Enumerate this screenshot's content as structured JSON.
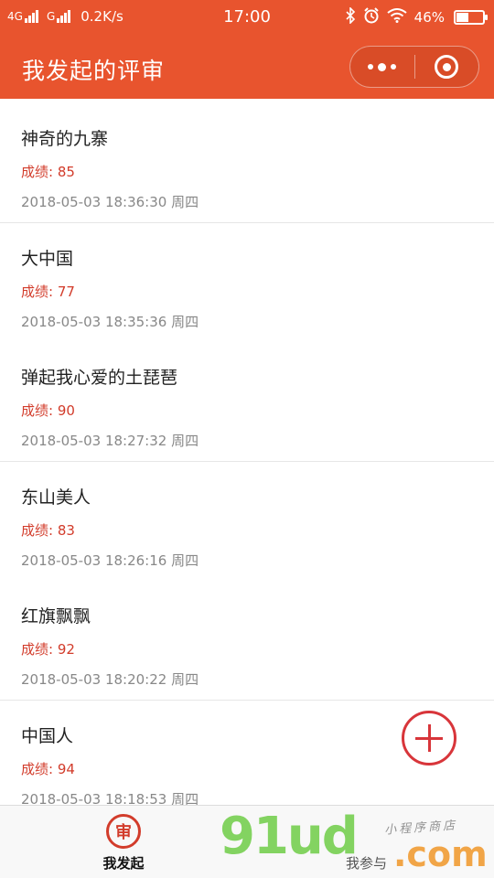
{
  "status_bar": {
    "network_1": "4G",
    "network_2": "G",
    "speed": "0.2K/s",
    "time": "17:00",
    "battery": "46%",
    "battery_level": 0.46,
    "icons": [
      "bluetooth-icon",
      "alarm-icon",
      "wifi-icon"
    ]
  },
  "nav": {
    "title": "我发起的评审"
  },
  "items": [
    {
      "name": "神奇的九寨",
      "score": "成绩: 85",
      "time": "2018-05-03 18:36:30 周四"
    },
    {
      "name": "大中国",
      "score": "成绩: 77",
      "time": "2018-05-03 18:35:36 周四"
    },
    {
      "name": "弹起我心爱的土琵琶",
      "score": "成绩: 90",
      "time": "2018-05-03 18:27:32 周四"
    },
    {
      "name": "东山美人",
      "score": "成绩: 83",
      "time": "2018-05-03 18:26:16 周四"
    },
    {
      "name": "红旗飘飘",
      "score": "成绩: 92",
      "time": "2018-05-03 18:20:22 周四"
    },
    {
      "name": "中国人",
      "score": "成绩: 94",
      "time": "2018-05-03 18:18:53 周四"
    }
  ],
  "tabs": [
    {
      "icon_char": "审",
      "label": "我发起"
    },
    {
      "label": "我参与"
    }
  ],
  "watermark": {
    "main": "91ud",
    "com": ".com",
    "sub": "小程序商店"
  },
  "colors": {
    "brand": "#e8542e",
    "accent": "#d23c2b",
    "fab": "#d8353a"
  }
}
